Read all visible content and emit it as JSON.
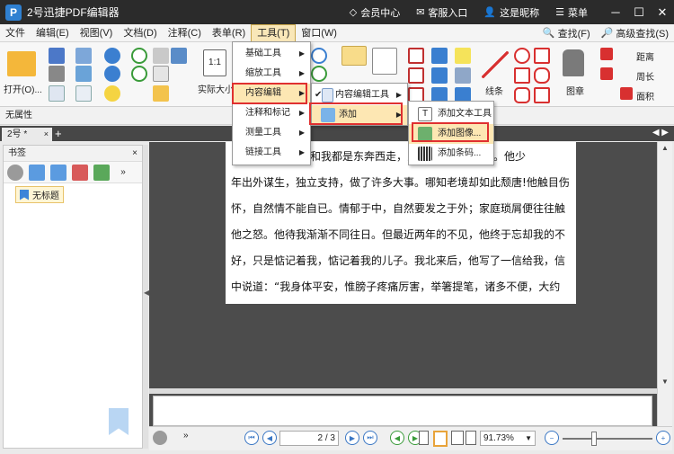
{
  "titlebar": {
    "logo": "P",
    "title": "2号迅捷PDF编辑器",
    "links": [
      {
        "icon": "diamond-icon",
        "label": "会员中心"
      },
      {
        "icon": "mail-icon",
        "label": "客服入口"
      },
      {
        "icon": "user-icon",
        "label": "这是昵称"
      },
      {
        "icon": "menu-icon",
        "label": "菜单"
      }
    ],
    "minimize": "─",
    "maximize": "☐",
    "close": "✕"
  },
  "menubar": {
    "items": [
      "文件",
      "编辑(E)",
      "视图(V)",
      "文档(D)",
      "注释(C)",
      "表单(R)",
      "工具(T)",
      "窗口(W)"
    ],
    "active_index": 6,
    "find": "查找(F)",
    "advanced_find": "高级查找(S)"
  },
  "ribbon": {
    "open_label": "打开(O)...",
    "actual_size_label": "实际大小",
    "actual_size_glyph": "1:1",
    "line_label": "线条",
    "stamp_label": "图章",
    "distance_label": "距离",
    "perimeter_label": "周长",
    "area_label": "面积"
  },
  "propbar": {
    "label": "无属性"
  },
  "tabs": {
    "doc_tab": "2号 *",
    "close": "×",
    "add": "+",
    "scroll": "◀ ▶"
  },
  "sidebar": {
    "title": "书签",
    "close": "×",
    "bookmark": "无标题"
  },
  "document": {
    "lines": [
      "父亲和我都是东奔西走，家境一日不如一日。他少",
      "年出外谋生，独立支持，做了许多大事。哪知老境却如此颓唐!他触目伤",
      "怀，自然情不能自已。情郁于中，自然要发之于外；家庭琐屑便往往触",
      "他之怒。他待我渐渐不同往日。但最近两年的不见，他终于忘却我的不",
      "好，只是惦记着我，惦记着我的儿子。我北来后，他写了一信给我，信",
      "中说道：“我身体平安，惟膀子疼痛厉害，举箸提笔，诸多不便，大约"
    ]
  },
  "statusbar": {
    "page_current": "2",
    "page_total": "/ 3",
    "zoom": "91.73%",
    "zoom_fraction": 0.35
  },
  "menus": {
    "tools": [
      {
        "label": "基础工具",
        "has_sub": true
      },
      {
        "label": "缩放工具",
        "has_sub": true
      },
      {
        "label": "内容编辑",
        "has_sub": true,
        "highlight": true
      },
      {
        "label": "注释和标记",
        "has_sub": true
      },
      {
        "label": "测量工具",
        "has_sub": true
      },
      {
        "label": "链接工具",
        "has_sub": true
      }
    ],
    "content_edit": [
      {
        "label": "内容编辑工具",
        "has_sub": true,
        "checked": true
      },
      {
        "label": "添加",
        "has_sub": true,
        "highlight": true
      }
    ],
    "add": [
      {
        "label": "添加文本工具"
      },
      {
        "label": "添加图像...",
        "highlight": true
      },
      {
        "label": "添加条码..."
      }
    ]
  },
  "colors": {
    "titlebar": "#2b2b2b",
    "accent": "#2f80d1",
    "highlight_red": "#e03030",
    "menu_highlight": "#fde7b3"
  }
}
